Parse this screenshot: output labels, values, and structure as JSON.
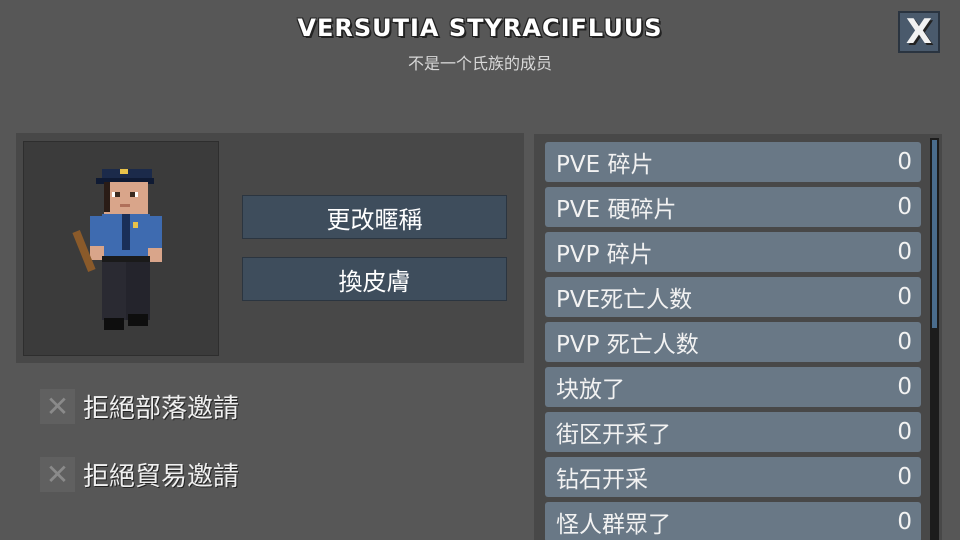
{
  "header": {
    "title": "VERSUTIA STYRACIFLUUS",
    "subtitle": "不是一个氏族的成员",
    "close_label": "X"
  },
  "buttons": {
    "change_nickname": "更改暱稱",
    "change_skin": "換皮膚"
  },
  "options": [
    {
      "label": "拒絕部落邀請",
      "checked": true
    },
    {
      "label": "拒絕貿易邀請",
      "checked": true
    }
  ],
  "stats": [
    {
      "label": "PVE 碎片",
      "value": "0"
    },
    {
      "label": "PVE 硬碎片",
      "value": "0"
    },
    {
      "label": "PVP 碎片",
      "value": "0"
    },
    {
      "label": "PVE死亡人数",
      "value": "0"
    },
    {
      "label": "PVP 死亡人数",
      "value": "0"
    },
    {
      "label": "块放了",
      "value": "0"
    },
    {
      "label": "街区开采了",
      "value": "0"
    },
    {
      "label": "钻石开采",
      "value": "0"
    },
    {
      "label": "怪人群眾了",
      "value": "0"
    }
  ],
  "scroll_position": 0
}
